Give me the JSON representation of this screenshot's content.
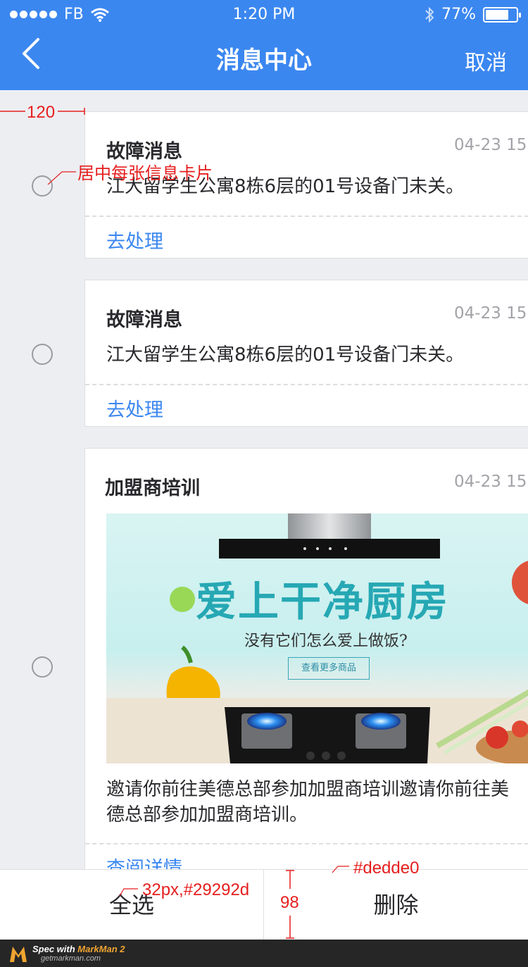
{
  "status_bar": {
    "carrier": "FB",
    "time": "1:20 PM",
    "battery": "77%",
    "battery_level": 0.77,
    "icons": [
      "signal-dots-icon",
      "wifi-icon",
      "bluetooth-icon",
      "battery-icon"
    ]
  },
  "nav": {
    "title": "消息中心",
    "cancel": "取消",
    "back_icon": "chevron-left-icon"
  },
  "messages": [
    {
      "title": "故障消息",
      "time": "04-23 15:",
      "body": "江大留学生公寓8栋6层的01号设备门未关。",
      "action": "去处理"
    },
    {
      "title": "故障消息",
      "time": "04-23 15:",
      "body": "江大留学生公寓8栋6层的01号设备门未关。",
      "action": "去处理"
    },
    {
      "title": "加盟商培训",
      "time": "04-23 15:",
      "banner": {
        "headline": "爱上干净厨房",
        "subline": "没有它们怎么爱上做饭?",
        "button": "查看更多商品"
      },
      "body_line1": "邀请你前往美德总部参加加盟商培训邀请你前往美",
      "body_line2": "德总部参加加盟商培训。",
      "action": "查阅详情"
    }
  ],
  "bottom_bar": {
    "select_all": "全选",
    "delete": "删除"
  },
  "annotations": {
    "width": "120",
    "center_note": "居中每张信息卡片",
    "border_color": "#dedde0",
    "font_spec": "32px,#29292d",
    "height": "98"
  },
  "watermark": {
    "line1_prefix": "Spec with ",
    "line1_brand": "MarkMan 2",
    "line2": "getmarkman.com"
  },
  "colors": {
    "primary": "#3b87f0",
    "text": "#29292d",
    "divider": "#dedde0",
    "background": "#edeef2",
    "annotation": "#e61e1e"
  }
}
